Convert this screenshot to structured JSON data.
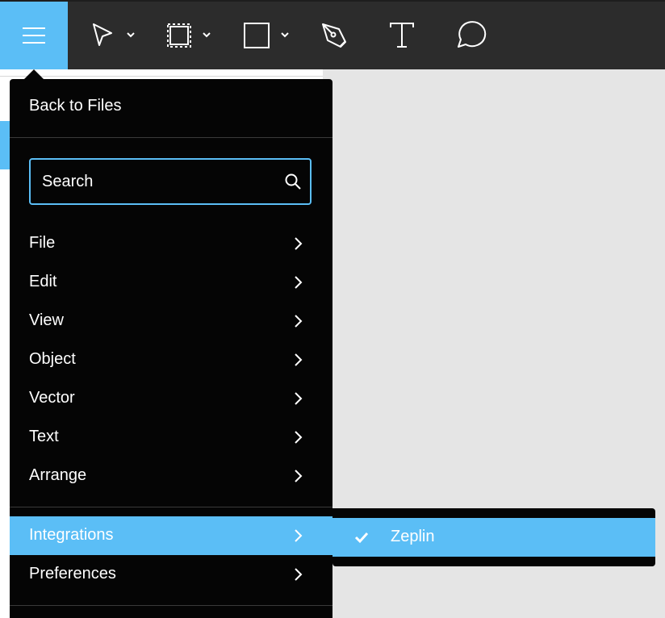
{
  "toolbar": {
    "tools": [
      {
        "name": "menu-icon"
      },
      {
        "name": "move-tool-icon",
        "has_dropdown": true
      },
      {
        "name": "frame-tool-icon",
        "has_dropdown": true
      },
      {
        "name": "rectangle-tool-icon",
        "has_dropdown": true
      },
      {
        "name": "pen-tool-icon"
      },
      {
        "name": "text-tool-icon"
      },
      {
        "name": "comment-tool-icon"
      }
    ],
    "accent_color": "#5bbef6",
    "background_color": "#2c2c2c"
  },
  "menu": {
    "back_label": "Back to Files",
    "search": {
      "placeholder": "Search",
      "value": ""
    },
    "items": [
      {
        "label": "File"
      },
      {
        "label": "Edit"
      },
      {
        "label": "View"
      },
      {
        "label": "Object"
      },
      {
        "label": "Vector"
      },
      {
        "label": "Text"
      },
      {
        "label": "Arrange"
      },
      {
        "label": "Integrations",
        "active": true
      },
      {
        "label": "Preferences"
      }
    ]
  },
  "submenu": {
    "items": [
      {
        "label": "Zeplin",
        "checked": true
      }
    ]
  }
}
